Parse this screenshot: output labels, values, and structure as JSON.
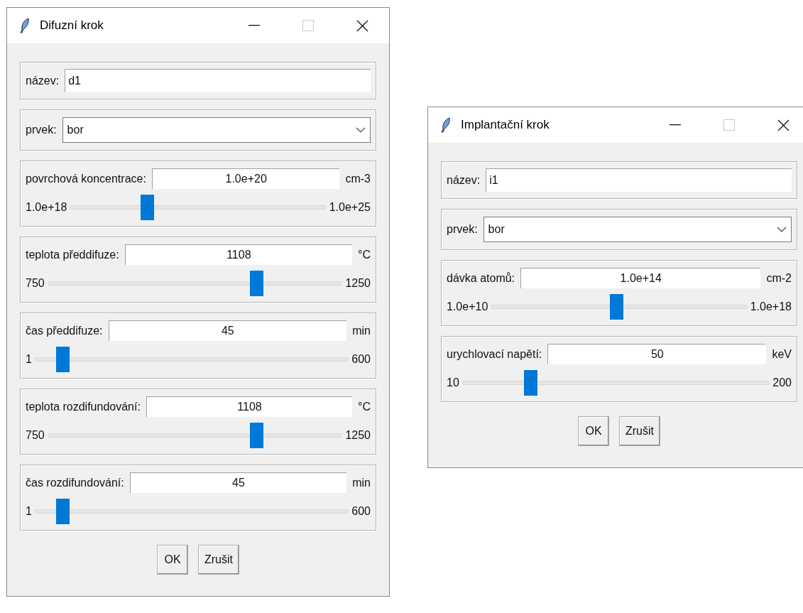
{
  "windows": [
    {
      "title": "Difuzní krok",
      "sections": [
        {
          "kind": "entry",
          "label": "název:",
          "value": "d1"
        },
        {
          "kind": "select",
          "label": "prvek:",
          "value": "bor"
        },
        {
          "kind": "slider",
          "label": "povrchová koncentrace:",
          "value": "1.0e+20",
          "unit": "cm-3",
          "min": "1.0e+18",
          "max": "1.0e+25",
          "level": 0.29
        },
        {
          "kind": "slider",
          "label": "teplota předdifuze:",
          "value": "1108",
          "unit": "°C",
          "min": "750",
          "max": "1250",
          "level": 0.72
        },
        {
          "kind": "slider",
          "label": "čas předdifuze:",
          "value": "45",
          "unit": "min",
          "min": "1",
          "max": "600",
          "level": 0.07
        },
        {
          "kind": "slider",
          "label": "teplota rozdifundování:",
          "value": "1108",
          "unit": "°C",
          "min": "750",
          "max": "1250",
          "level": 0.72
        },
        {
          "kind": "slider",
          "label": "čas rozdifundování:",
          "value": "45",
          "unit": "min",
          "min": "1",
          "max": "600",
          "level": 0.07
        }
      ],
      "buttons": [
        "OK",
        "Zrušit"
      ]
    },
    {
      "title": "Implantační krok",
      "sections": [
        {
          "kind": "entry",
          "label": "název:",
          "value": "i1"
        },
        {
          "kind": "select",
          "label": "prvek:",
          "value": "bor"
        },
        {
          "kind": "slider",
          "label": "dávka atomů:",
          "value": "1.0e+14",
          "unit": "cm-2",
          "min": "1.0e+10",
          "max": "1.0e+18",
          "level": 0.49
        },
        {
          "kind": "slider",
          "label": "urychlovací napětí:",
          "value": "50",
          "unit": "keV",
          "min": "10",
          "max": "200",
          "level": 0.21
        }
      ],
      "buttons": [
        "OK",
        "Zrušit"
      ]
    }
  ]
}
